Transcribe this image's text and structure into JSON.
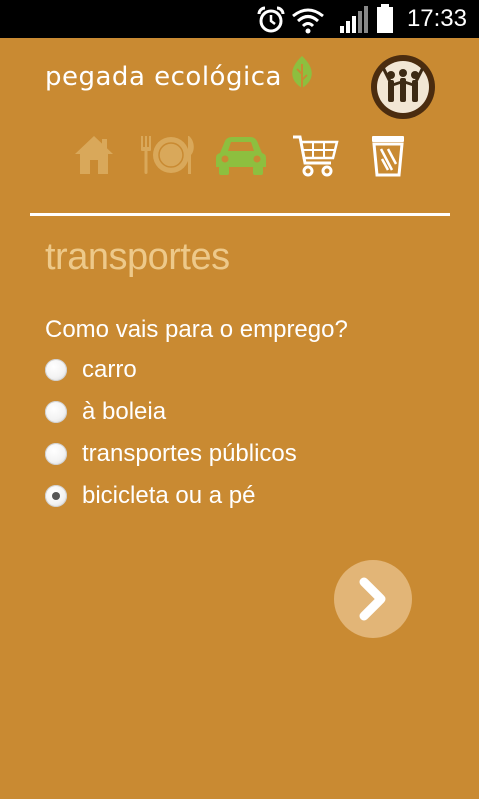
{
  "status_bar": {
    "time": "17:33",
    "icons": [
      "alarm-icon",
      "wifi-icon",
      "signal-icon",
      "battery-icon"
    ]
  },
  "header": {
    "brand": "pegada ecológica",
    "brand_icon": "leaf-icon",
    "profile_icon": "people-group-icon"
  },
  "categories": [
    {
      "name": "home",
      "icon": "house-icon",
      "state": "done"
    },
    {
      "name": "food",
      "icon": "plate-cutlery-icon",
      "state": "done"
    },
    {
      "name": "transport",
      "icon": "car-icon",
      "state": "active"
    },
    {
      "name": "shopping",
      "icon": "cart-icon",
      "state": "pending"
    },
    {
      "name": "waste",
      "icon": "trash-icon",
      "state": "pending"
    }
  ],
  "section": {
    "title": "transportes",
    "question": "Como vais para o emprego?",
    "options": [
      {
        "label": "carro",
        "selected": false
      },
      {
        "label": "à boleia",
        "selected": false
      },
      {
        "label": "transportes públicos",
        "selected": false
      },
      {
        "label": "bicicleta ou a pé",
        "selected": true
      }
    ]
  },
  "next_icon": "chevron-right-icon",
  "colors": {
    "background": "#c98a32",
    "accent_green": "#8dbf3f",
    "title": "#edc98a",
    "faded_icon": "#d9a85a",
    "next_button": "#e2b577"
  }
}
